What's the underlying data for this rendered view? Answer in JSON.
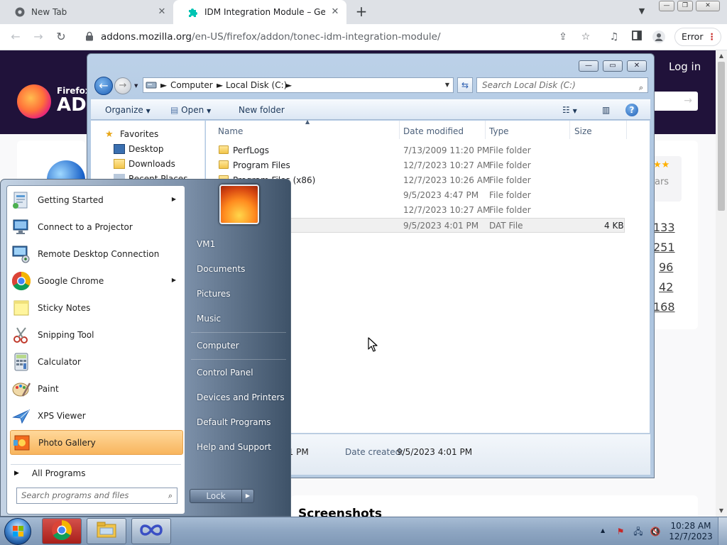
{
  "browser": {
    "tabs": [
      {
        "title": "New Tab",
        "close": "✕"
      },
      {
        "title": "IDM Integration Module – Get this Extension for Firefox (en-US)",
        "close": "✕"
      }
    ],
    "new_tab_symbol": "+",
    "url_host": "addons.mozilla.org",
    "url_path": "/en-US/firefox/addon/tonec-idm-integration-module/",
    "error_label": "Error",
    "nav": {
      "back": "←",
      "forward": "→",
      "reload": "↻"
    },
    "icons": [
      "chrome-icon",
      "share-icon",
      "star-icon",
      "media-icon",
      "sidepanel-icon",
      "profile-icon",
      "menu-icon"
    ]
  },
  "page": {
    "login": "Log in",
    "logo_word": "Firefox",
    "logo_title": "AD",
    "rating_word": "ars",
    "counts": [
      "133",
      "251",
      "96",
      "42",
      "168"
    ],
    "screenshots_heading": "Screenshots",
    "colors": {
      "header_bg": "#20123a",
      "page_bg": "#f9f9fa"
    }
  },
  "explorer": {
    "breadcrumbs": [
      "Computer",
      "Local Disk (C:)"
    ],
    "search_placeholder": "Search Local Disk (C:)",
    "commands": {
      "organize": "Organize",
      "open": "Open",
      "new_folder": "New folder"
    },
    "nav_items": [
      "Favorites",
      "Desktop",
      "Downloads",
      "Recent Places"
    ],
    "columns": [
      "Name",
      "Date modified",
      "Type",
      "Size"
    ],
    "files": [
      {
        "name": "PerfLogs",
        "date": "7/13/2009 11:20 PM",
        "type": "File folder",
        "size": ""
      },
      {
        "name": "Program Files",
        "date": "12/7/2023 10:27 AM",
        "type": "File folder",
        "size": ""
      },
      {
        "name": "Program Files (x86)",
        "date": "12/7/2023 10:26 AM",
        "type": "File folder",
        "size": ""
      },
      {
        "name": "",
        "date": "9/5/2023 4:47 PM",
        "type": "File folder",
        "size": ""
      },
      {
        "name": "",
        "date": "12/7/2023 10:27 AM",
        "type": "File folder",
        "size": ""
      },
      {
        "name": "",
        "date": "9/5/2023 4:01 PM",
        "type": "DAT File",
        "size": "4 KB"
      }
    ],
    "details": {
      "modified_partial": "01 PM",
      "created_label": "Date created:",
      "created_value": "9/5/2023 4:01 PM"
    }
  },
  "start_menu": {
    "programs": [
      {
        "label": "Getting Started",
        "icon": "getting-started-icon",
        "arrow": true
      },
      {
        "label": "Connect to a Projector",
        "icon": "projector-icon",
        "arrow": false
      },
      {
        "label": "Remote Desktop Connection",
        "icon": "remote-desktop-icon",
        "arrow": false
      },
      {
        "label": "Google Chrome",
        "icon": "chrome-icon",
        "arrow": true
      },
      {
        "label": "Sticky Notes",
        "icon": "sticky-notes-icon",
        "arrow": false
      },
      {
        "label": "Snipping Tool",
        "icon": "scissors-icon",
        "arrow": false
      },
      {
        "label": "Calculator",
        "icon": "calculator-icon",
        "arrow": false
      },
      {
        "label": "Paint",
        "icon": "paint-icon",
        "arrow": false
      },
      {
        "label": "XPS Viewer",
        "icon": "xps-viewer-icon",
        "arrow": false
      },
      {
        "label": "Photo Gallery",
        "icon": "photo-gallery-icon",
        "arrow": false
      }
    ],
    "all_programs": "All Programs",
    "search_placeholder": "Search programs and files",
    "links": [
      "VM1",
      "Documents",
      "Pictures",
      "Music",
      "Computer",
      "Control Panel",
      "Devices and Printers",
      "Default Programs",
      "Help and Support"
    ],
    "lock_label": "Lock"
  },
  "taskbar": {
    "time": "10:28 AM",
    "date": "12/7/2023"
  }
}
